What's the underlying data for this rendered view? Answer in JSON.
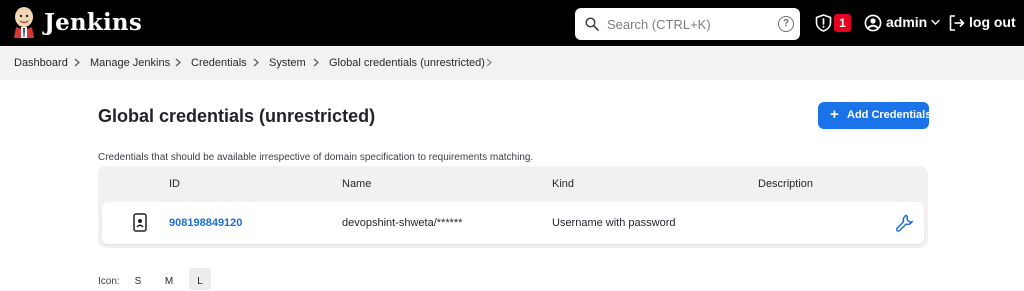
{
  "header": {
    "brand": "Jenkins",
    "search_placeholder": "Search (CTRL+K)",
    "help_label": "?",
    "notification_count": "1",
    "user_name": "admin",
    "logout_label": "log out"
  },
  "breadcrumb": {
    "items": [
      "Dashboard",
      "Manage Jenkins",
      "Credentials",
      "System",
      "Global credentials (unrestricted)"
    ]
  },
  "main": {
    "title": "Global credentials (unrestricted)",
    "add_button_label": "Add Credentials",
    "description": "Credentials that should be available irrespective of domain specification to requirements matching.",
    "table": {
      "columns": [
        "ID",
        "Name",
        "Kind",
        "Description"
      ],
      "rows": [
        {
          "id": "908198849120",
          "name": "devopshint-shweta/******",
          "kind": "Username with password",
          "description": ""
        }
      ]
    }
  },
  "icon_size": {
    "label": "Icon:",
    "options": [
      "S",
      "M",
      "L"
    ],
    "selected": "L"
  },
  "colors": {
    "header_bg": "#000000",
    "accent": "#1a73e8",
    "link": "#1a6fd6",
    "badge": "#e6001f"
  }
}
